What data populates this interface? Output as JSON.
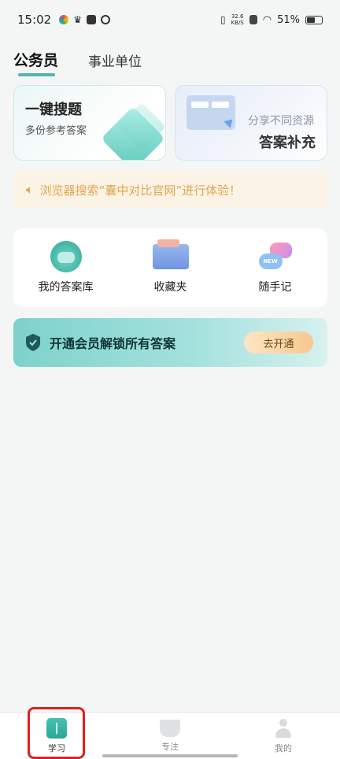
{
  "status_bar": {
    "time": "15:02",
    "net_speed_value": "32.6",
    "net_speed_unit": "KB/S",
    "battery": "51%"
  },
  "tabs": [
    {
      "label": "公务员",
      "active": true
    },
    {
      "label": "事业单位",
      "active": false
    }
  ],
  "cards": {
    "left": {
      "title": "一键搜题",
      "subtitle": "多份参考答案"
    },
    "right": {
      "subtitle": "分享不同资源",
      "title": "答案补充"
    }
  },
  "notice": {
    "text": "浏览器搜索“囊中对比官网”进行体验！",
    "icon": "speaker-icon"
  },
  "quick_actions": [
    {
      "label": "我的答案库",
      "icon": "frog-icon"
    },
    {
      "label": "收藏夹",
      "icon": "folder-icon"
    },
    {
      "label": "随手记",
      "icon": "chat-bubbles-icon",
      "badge": "NEW"
    }
  ],
  "membership": {
    "text": "开通会员解锁所有答案",
    "button": "去开通",
    "icon": "badge-icon"
  },
  "bottom_nav": [
    {
      "label": "学习",
      "icon": "book-icon",
      "active": true
    },
    {
      "label": "专注",
      "icon": "cup-icon",
      "active": false
    },
    {
      "label": "我的",
      "icon": "user-icon",
      "active": false
    }
  ],
  "colors": {
    "accent": "#4fb7b0",
    "notice_text": "#e2a44d",
    "highlight": "#e02020"
  }
}
